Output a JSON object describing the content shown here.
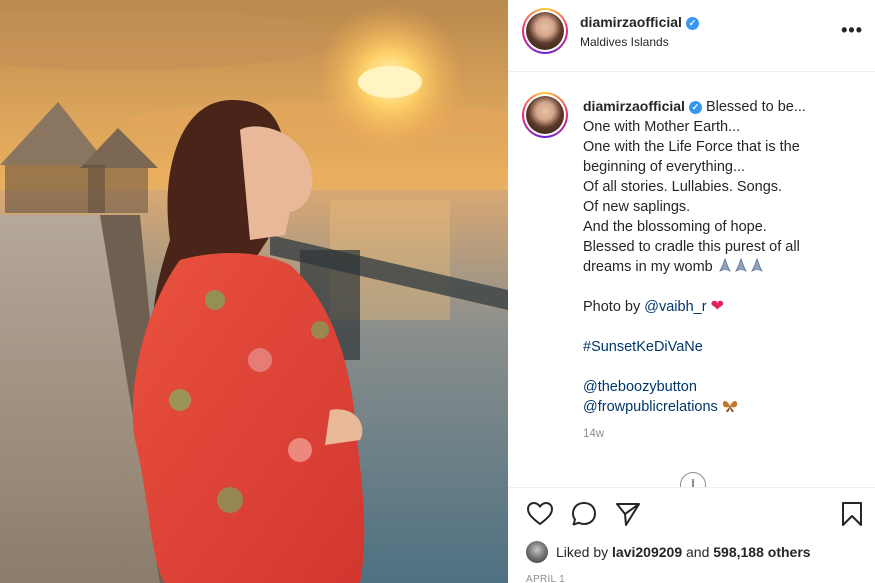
{
  "post": {
    "username": "diamirzaofficial",
    "verified_mark": "✓",
    "location": "Maldives Islands",
    "more_label": "•••",
    "time_ago": "14w",
    "date": "APRIL 1"
  },
  "caption": {
    "lines": [
      "Blessed to be...",
      "One with Mother Earth...",
      "One with the Life Force that is the",
      "beginning of everything...",
      "Of all stories. Lullabies. Songs.",
      "Of new saplings.",
      "And the blossoming of hope.",
      "Blessed to cradle this purest of all",
      "dreams in my womb"
    ],
    "photo_by_prefix": "Photo by ",
    "photo_by_handle": "@vaibh_r",
    "hashtag": "#SunsetKeDiVaNe",
    "mention_1": "@theboozybutton",
    "mention_2": "@frowpublicrelations"
  },
  "likes": {
    "prefix": "Liked by ",
    "user": "lavi209209",
    "middle": " and ",
    "count": "598,188 others"
  },
  "icons": {
    "header_avatar": "profile-avatar",
    "verified": "verified-badge-icon",
    "more": "more-options-icon",
    "like": "heart-outline-icon",
    "comment": "comment-bubble-icon",
    "share": "paper-plane-icon",
    "save": "bookmark-icon",
    "load_more": "plus-circle-icon"
  },
  "colors": {
    "link": "#00376b",
    "verified": "#3897f0",
    "heart": "#e0245e",
    "muted": "#8e8e8e"
  }
}
